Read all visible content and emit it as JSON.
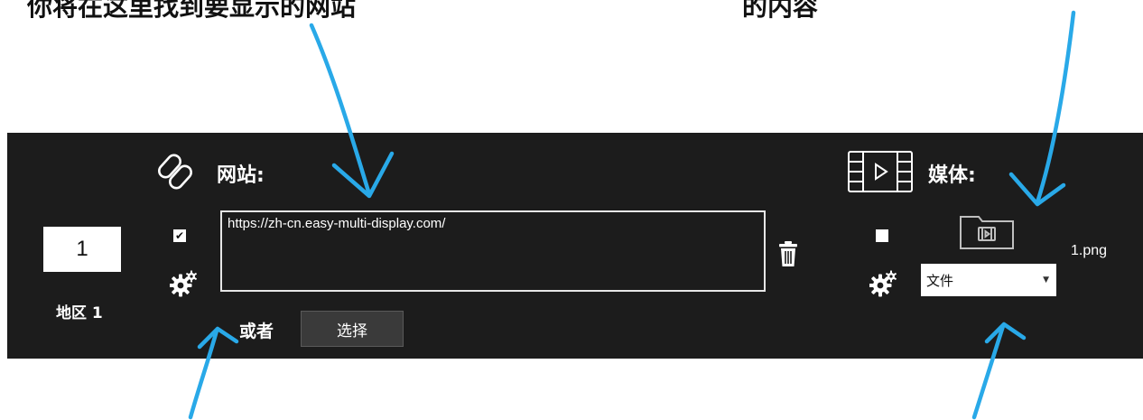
{
  "caption": {
    "left_text": "你将在这里找到要显示的网站",
    "right_text": "的内容"
  },
  "panel": {
    "region": {
      "number": "1",
      "label": "地区 1"
    },
    "website": {
      "title": "网站:",
      "enabled": true,
      "url": "https://zh-cn.easy-multi-display.com/",
      "or_label": "或者",
      "select_label": "选择"
    },
    "media": {
      "title": "媒体:",
      "enabled": false,
      "file_name": "1.png",
      "source_type": "文件"
    }
  },
  "colors": {
    "panel_bg": "#1c1c1c",
    "arrow": "#29a9e8",
    "text": "#ffffff"
  },
  "icons": [
    "link-icon",
    "checkbox-icon",
    "gear-icon",
    "trash-icon",
    "film-icon",
    "folder-icon",
    "chevron-down-icon"
  ]
}
